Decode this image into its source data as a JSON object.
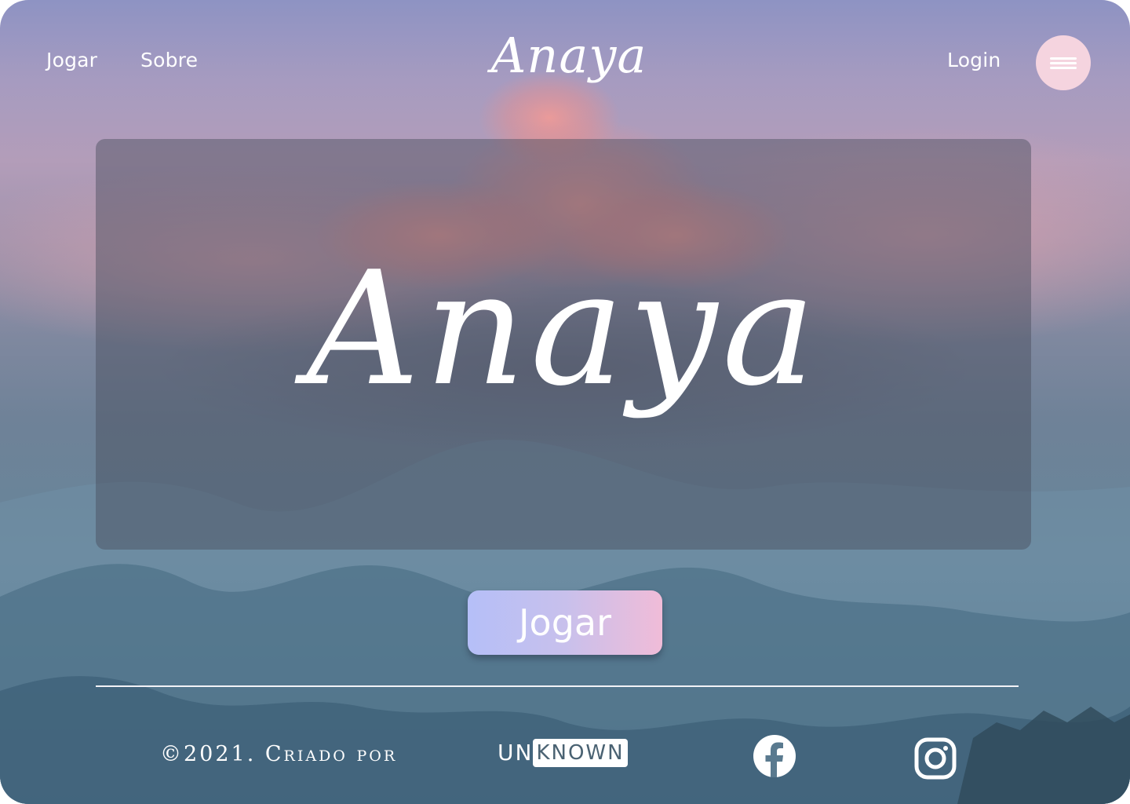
{
  "nav": {
    "links": [
      {
        "label": "Jogar"
      },
      {
        "label": "Sobre"
      }
    ],
    "brand": "Anaya",
    "login_label": "Login",
    "menu_icon": "hamburger-menu-icon"
  },
  "hero": {
    "title": "Anaya",
    "play_label": "Jogar"
  },
  "footer": {
    "copyright": "©2021. Criado por",
    "logo": {
      "prefix": "UN",
      "rest": "KNOWN"
    },
    "social": [
      {
        "icon": "facebook-icon"
      },
      {
        "icon": "instagram-icon"
      }
    ]
  },
  "colors": {
    "menu_button": "#f5d4df",
    "play_gradient_start": "#b5bff8",
    "play_gradient_end": "#f0bcd8",
    "text": "#ffffff"
  }
}
